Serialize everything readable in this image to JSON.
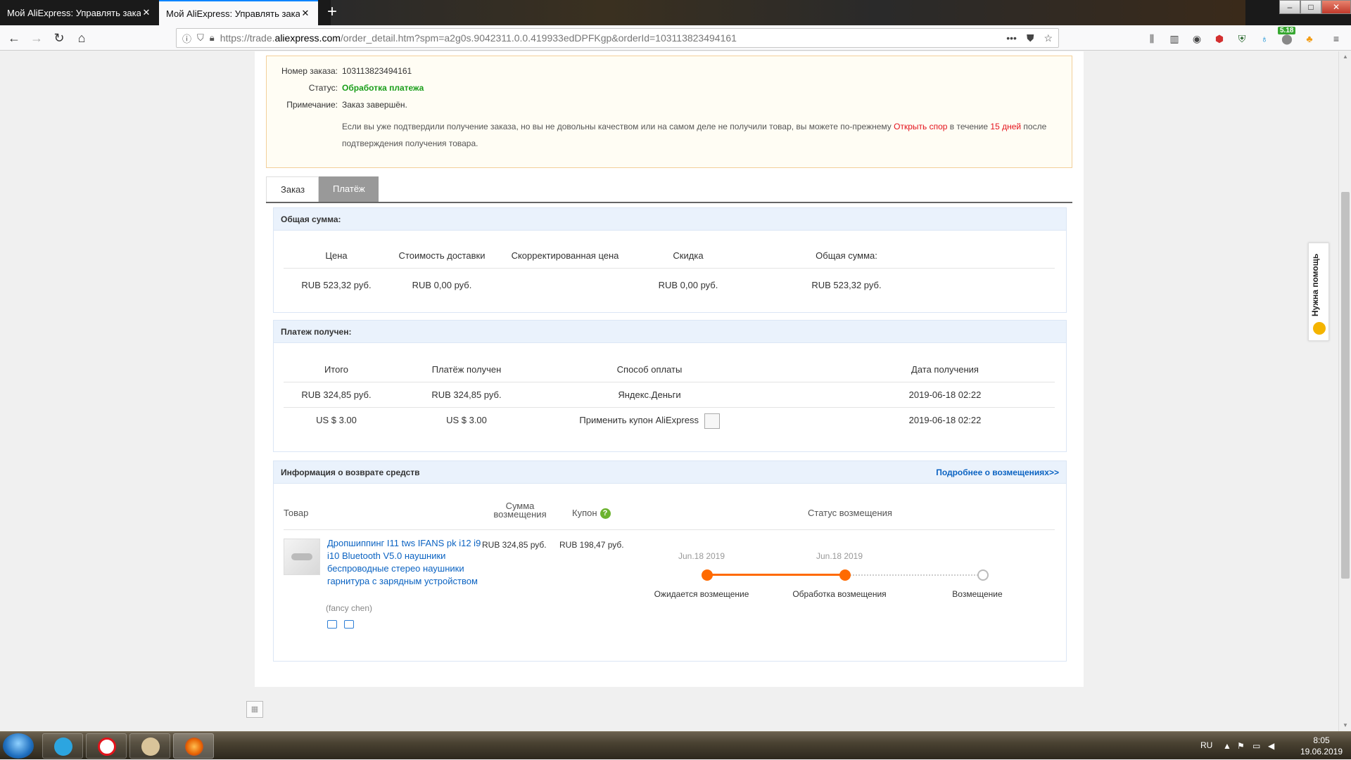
{
  "browser": {
    "tabs": [
      {
        "title": "Мой AliExpress: Управлять заказами",
        "close": "✕"
      },
      {
        "title": "Мой AliExpress: Управлять заказами",
        "close": "✕"
      }
    ],
    "new_tab": "+",
    "url": {
      "prefix": "https://trade.",
      "host": "aliexpress.com",
      "path": "/order_detail.htm?spm=a2g0s.9042311.0.0.419933edDPFKgp&orderId=103113823494161"
    },
    "ext_badge": "5.18"
  },
  "order": {
    "number_label": "Номер заказа:",
    "number": "103113823494161",
    "status_label": "Статус:",
    "status": "Обработка платежа",
    "note_label": "Примечание:",
    "note": "Заказ завершён.",
    "notice_part1": "Если вы уже подтвердили получение заказа, но вы не довольны качеством или на самом деле не получили товар, вы можете по-прежнему ",
    "notice_link": "Открыть спор",
    "notice_part2": " в течение ",
    "notice_days": "15 дней",
    "notice_part3": " после подтверждения получения товара."
  },
  "page_tabs": {
    "order": "Заказ",
    "payment": "Платёж"
  },
  "total": {
    "heading": "Общая сумма:",
    "headers": [
      "Цена",
      "Стоимость доставки",
      "Скорректированная цена",
      "Скидка",
      "Общая сумма:"
    ],
    "row": [
      "RUB 523,32 руб.",
      "RUB 0,00 руб.",
      "",
      "RUB 0,00 руб.",
      "RUB 523,32 руб."
    ]
  },
  "payment": {
    "heading": "Платеж получен:",
    "headers": [
      "Итого",
      "Платёж получен",
      "Способ оплаты",
      "Дата получения"
    ],
    "rows": [
      [
        "RUB 324,85 руб.",
        "RUB 324,85 руб.",
        "Яндекс.Деньги",
        "2019-06-18 02:22"
      ],
      [
        "US $ 3.00",
        "US $ 3.00",
        "Применить купон AliExpress",
        "2019-06-18 02:22"
      ]
    ]
  },
  "refund": {
    "heading": "Информация о возврате средств",
    "more_link": "Подробнее о возмещениях>>",
    "headers": {
      "product": "Товар",
      "amount_line1": "Сумма",
      "amount_line2": "возмещения",
      "coupon": "Купон",
      "coupon_help": "?",
      "status": "Статус возмещения"
    },
    "product_title": "Дропшиппинг I11 tws IFANS pk i12 i9 i10 Bluetooth V5.0 наушники беспроводные стерео наушники гарнитура с зарядным устройством",
    "seller": "(fancy chen)",
    "amount": "RUB 324,85 руб.",
    "coupon": "RUB 198,47 руб.",
    "timeline": [
      {
        "date": "Jun.18 2019",
        "label": "Ожидается возмещение",
        "done": true
      },
      {
        "date": "Jun.18 2019",
        "label": "Обработка возмещения",
        "done": true
      },
      {
        "date": "",
        "label": "Возмещение",
        "done": false
      }
    ],
    "accent_color": "#ff6a00"
  },
  "help_widget": "Нужна помощь",
  "taskbar": {
    "lang": "RU",
    "time": "8:05",
    "date": "19.06.2019"
  }
}
